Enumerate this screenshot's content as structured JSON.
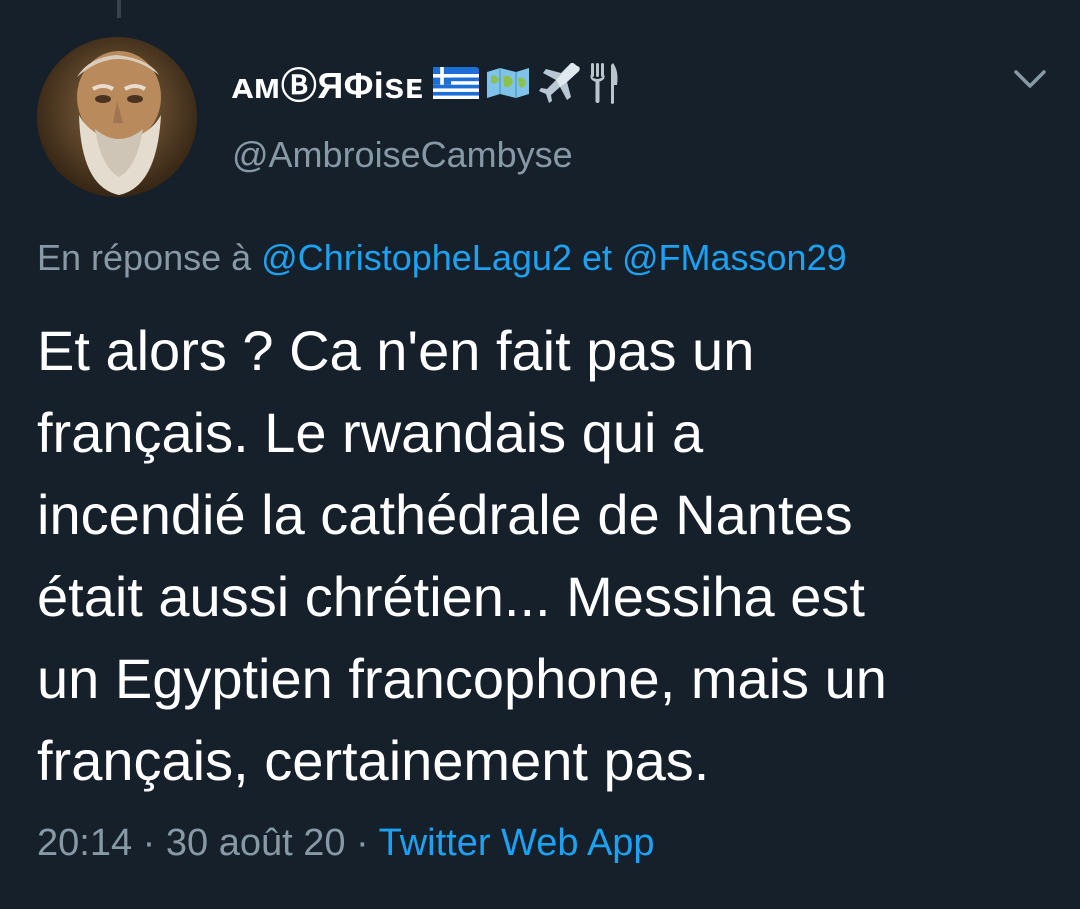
{
  "tweet": {
    "display_name": "ᴀᴍⒷЯΦisᴇ",
    "name_emojis": [
      "greece-flag-icon",
      "world-map-icon",
      "airplane-icon",
      "fork-knife-icon"
    ],
    "handle": "@AmbroiseCambyse",
    "reply_prefix": "En réponse à",
    "reply_mention_1": "@ChristopheLagu2",
    "reply_conjunction": "et",
    "reply_mention_2": "@FMasson29",
    "text_lines": [
      "Et alors ? Ca n'en fait pas un",
      "français. Le rwandais qui a",
      "incendié la cathédrale de Nantes",
      "était aussi chrétien... Messiha est",
      "un Egyptien francophone, mais un",
      "français, certainement pas."
    ],
    "time": "20:14",
    "separator": "·",
    "date": "30 août 20",
    "source": "Twitter Web App"
  },
  "colors": {
    "background": "#15202b",
    "primary_text": "#ffffff",
    "secondary_text": "#8899a6",
    "accent": "#1da1f2"
  }
}
